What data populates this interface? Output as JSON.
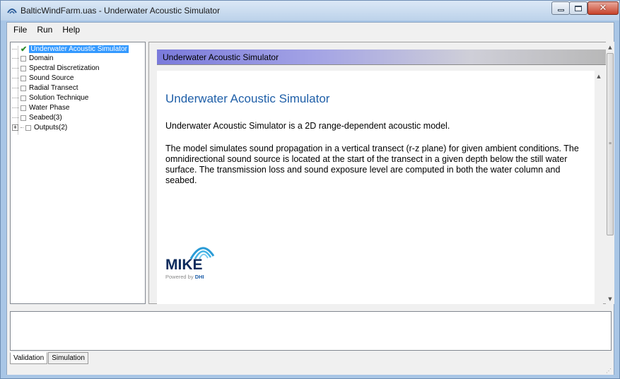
{
  "window": {
    "title": "BalticWindFarm.uas - Underwater Acoustic Simulator",
    "close_glyph": "✕"
  },
  "menu": {
    "items": [
      {
        "label": "File"
      },
      {
        "label": "Run"
      },
      {
        "label": "Help"
      }
    ]
  },
  "tree": {
    "items": [
      {
        "label": "Underwater Acoustic Simulator",
        "checked": true,
        "selected": true
      },
      {
        "label": "Domain"
      },
      {
        "label": "Spectral Discretization"
      },
      {
        "label": "Sound Source"
      },
      {
        "label": "Radial Transect"
      },
      {
        "label": "Solution Technique"
      },
      {
        "label": "Water Phase"
      },
      {
        "label": "Seabed(3)"
      },
      {
        "label": "Outputs(2)",
        "expandable": true
      }
    ],
    "check_glyph": "✔",
    "expander_glyph": "+"
  },
  "content": {
    "header": "Underwater Acoustic Simulator",
    "heading": "Underwater Acoustic Simulator",
    "paragraph1": "Underwater Acoustic Simulator is a 2D range-dependent acoustic model.",
    "paragraph2": "The model simulates sound propagation in a vertical transect (r-z plane) for given ambient conditions. The omnidirectional sound source is located at the start of the transect in a given depth below the still water surface. The transmission loss and sound exposure level are computed in both the water column and seabed."
  },
  "logo": {
    "name": "MIKE",
    "powered_by": "Powered by",
    "company": "DHI"
  },
  "tabs": [
    {
      "label": "Validation",
      "active": true
    },
    {
      "label": "Simulation",
      "active": false
    }
  ],
  "colors": {
    "heading": "#1f5fa8",
    "selection": "#3399ff",
    "check": "#2a8a2a"
  }
}
